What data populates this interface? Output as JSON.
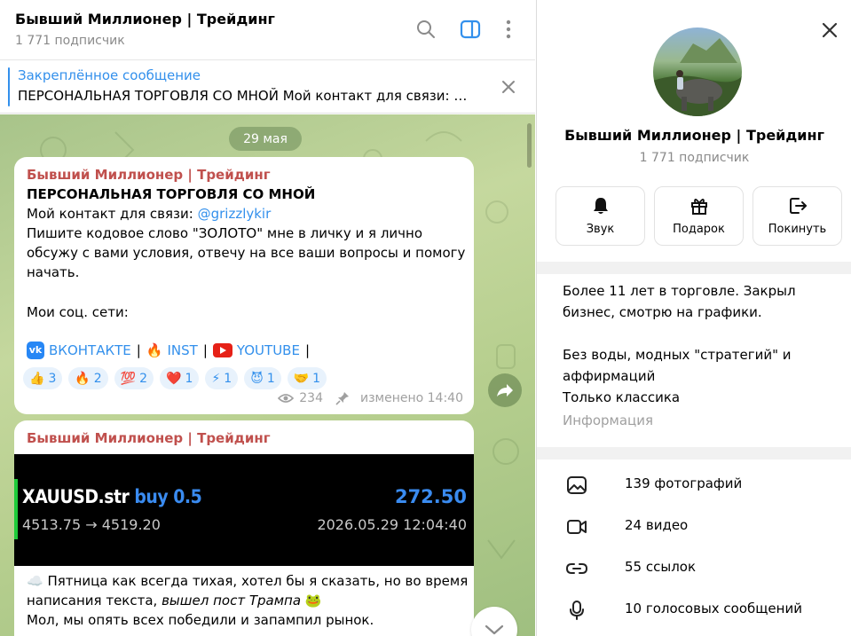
{
  "header": {
    "title": "Бывший Миллионер | Трейдинг",
    "subscribers": "1 771 подписчик"
  },
  "pinned": {
    "label": "Закреплённое сообщение",
    "text": "ПЕРСОНАЛЬНАЯ ТОРГОВЛЯ СО МНОЙ Мой контакт для связи: @grizzlykir"
  },
  "chat": {
    "date": "29 мая",
    "message1": {
      "sender": "Бывший Миллионер | Трейдинг",
      "line1": "ПЕРСОНАЛЬНАЯ ТОРГОВЛЯ СО МНОЙ",
      "line2_prefix": "Мой контакт для связи: ",
      "line2_link": "@grizzlykir",
      "line3": "Пишите кодовое слово \"ЗОЛОТО\" мне в личку и я лично",
      "line4": "обсужу с вами условия, отвечу на все ваши вопросы и помогу",
      "line5": "начать.",
      "line6": "Мои соц. сети:",
      "social_vk": "ВКОНТАКТЕ",
      "social_inst": "INST",
      "social_yt": "YOUTUBE",
      "sep": "|",
      "reactions": [
        {
          "emoji": "👍",
          "count": "3"
        },
        {
          "emoji": "🔥",
          "count": "2"
        },
        {
          "emoji": "💯",
          "count": "2"
        },
        {
          "emoji": "❤️",
          "count": "1"
        },
        {
          "emoji": "⚡",
          "count": "1"
        },
        {
          "emoji": "😈",
          "count": "1"
        },
        {
          "emoji": "🤝",
          "count": "1"
        }
      ],
      "views": "234",
      "edited": "изменено 14:40"
    },
    "message2": {
      "sender": "Бывший Миллионер | Трейдинг",
      "trade": {
        "symbol": "XAUUSD.str",
        "side": "buy 0.5",
        "pnl": "272.50",
        "prices": "4513.75 → 4519.20",
        "time": "2026.05.29 12:04:40"
      },
      "text_line1": "Пятница как всегда тихая, хотел бы я сказать, но во время",
      "text_line2_prefix": "написания текста, ",
      "text_line2_italic": "вышел пост Трампа",
      "text_line3": "Мол, мы опять всех победили и запампил рынок."
    }
  },
  "panel": {
    "title": "Бывший Миллионер | Трейдинг",
    "subscribers": "1 771 подписчик",
    "actions": {
      "sound": "Звук",
      "gift": "Подарок",
      "leave": "Покинуть"
    },
    "about": [
      "Более 11 лет в торговле. Закрыл",
      "бизнес, смотрю на графики.",
      "Без воды, модных \"стратегий\" и",
      "аффирмаций",
      "Только классика"
    ],
    "info_label": "Информация",
    "media": [
      {
        "label": "139 фотографий",
        "icon": "photo-icon"
      },
      {
        "label": "24 видео",
        "icon": "video-icon"
      },
      {
        "label": "55 ссылок",
        "icon": "link-icon"
      },
      {
        "label": "10 голосовых сообщений",
        "icon": "microphone-icon"
      }
    ]
  },
  "colors": {
    "accent": "#3390ec",
    "sender": "#c0504d",
    "trade_green": "#1ecb3a"
  }
}
